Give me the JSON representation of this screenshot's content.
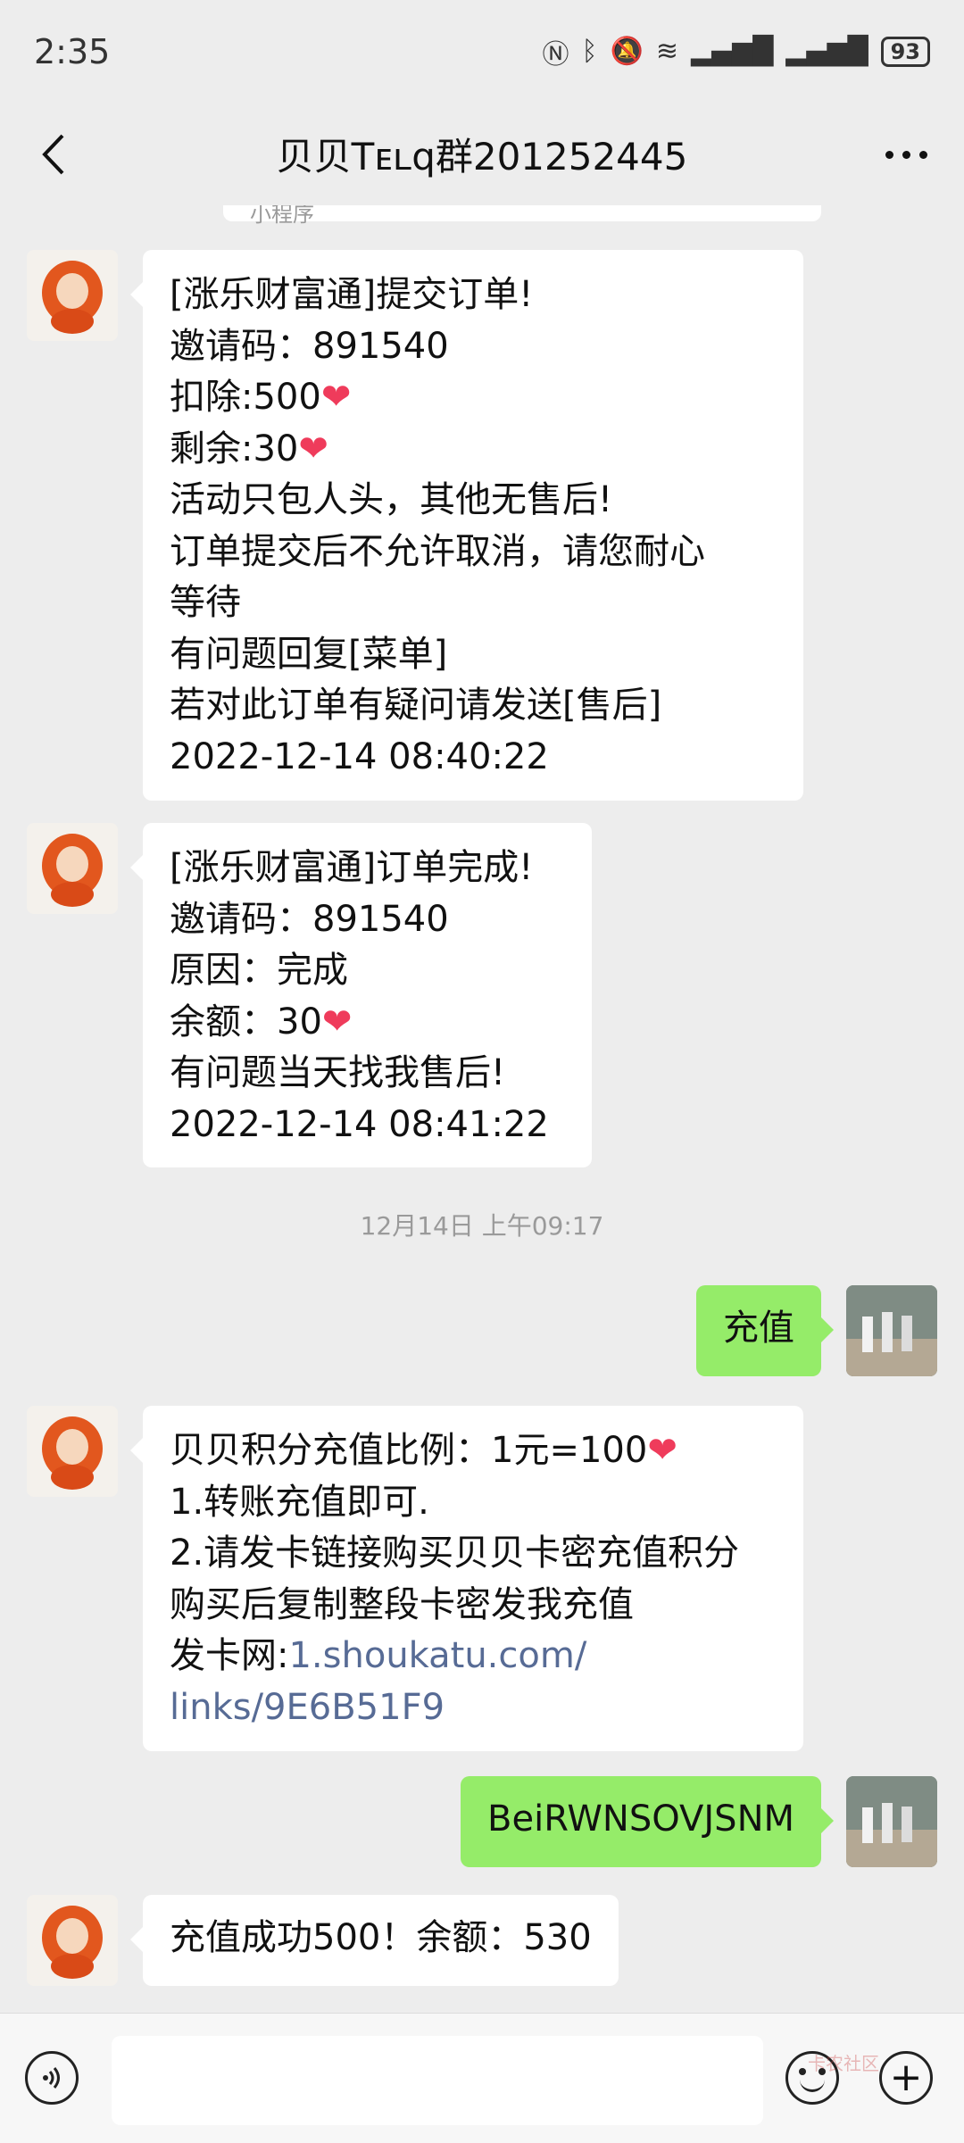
{
  "status_bar": {
    "time": "2:35",
    "battery": "93"
  },
  "header": {
    "title": "贝贝Tᴇʟq群201252445"
  },
  "prev_card": {
    "mini_program_label": "小程序"
  },
  "messages": [
    {
      "side": "left",
      "lines": [
        "[涨乐财富通]提交订单!",
        "邀请码：891540",
        "扣除:500",
        "剩余:30",
        "活动只包人头，其他无售后!",
        "订单提交后不允许取消，请您耐心",
        "等待",
        "有问题回复[菜单]",
        "若对此订单有疑问请发送[售后]",
        "2022-12-14 08:40:22"
      ]
    },
    {
      "side": "left",
      "lines": [
        "[涨乐财富通]订单完成!",
        "邀请码：891540",
        "原因：完成",
        "余额：30",
        "有问题当天找我售后!",
        "2022-12-14 08:41:22"
      ]
    },
    {
      "side": "right",
      "text": "充值"
    },
    {
      "side": "left",
      "lines": [
        "贝贝积分充值比例：1元=100",
        "1.转账充值即可.",
        "2.请发卡链接购买贝贝卡密充值积分",
        "购买后复制整段卡密发我充值",
        "发卡网:"
      ],
      "link": [
        "1.shoukatu.com/",
        "links/9E6B51F9"
      ]
    },
    {
      "side": "right",
      "text": "BeiRWNSOVJSNM"
    },
    {
      "side": "left",
      "text": "充值成功500！余额：530"
    }
  ],
  "time_divider": "12月14日 上午09:17",
  "watermark": "卡农社区",
  "icons": {
    "back": "chevron-left-icon",
    "more": "more-dots-icon",
    "voice": "voice-icon",
    "emoji": "emoji-icon",
    "plus": "plus-icon",
    "heart": "heart-icon"
  },
  "colors": {
    "background": "#ededed",
    "bubble_sent": "#95ec69",
    "bubble_received": "#ffffff",
    "link": "#576b95",
    "heart": "#ef3b5b"
  }
}
